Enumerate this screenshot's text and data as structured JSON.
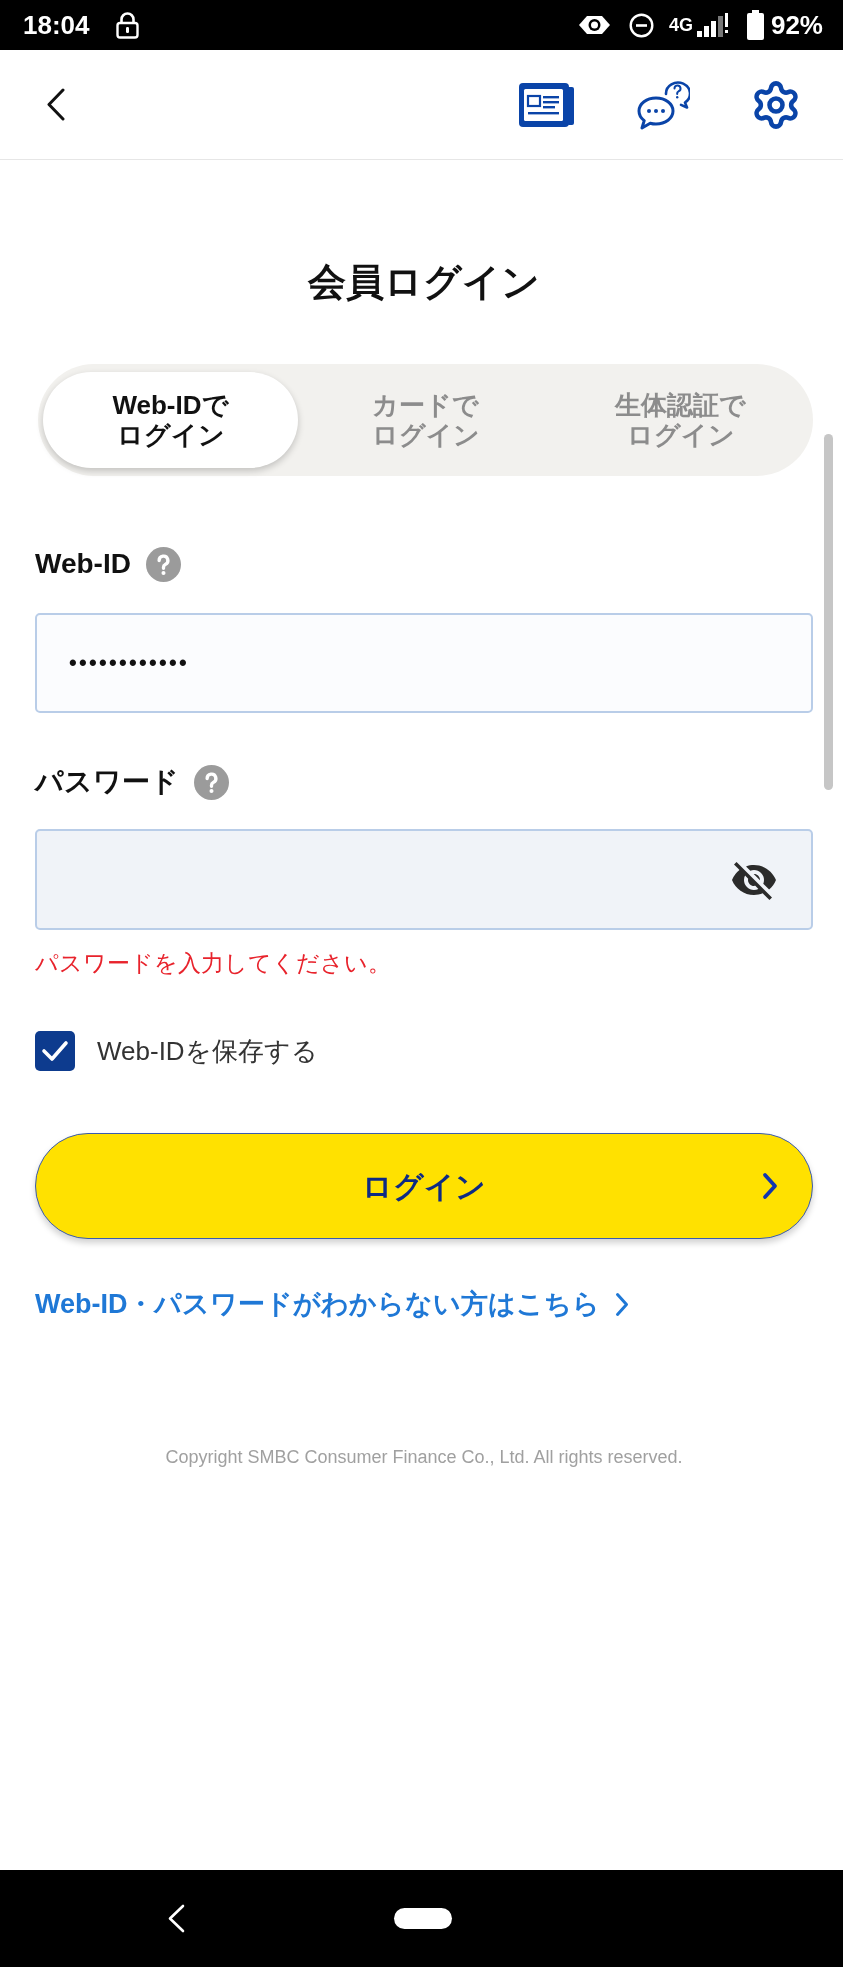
{
  "status_bar": {
    "time": "18:04",
    "network": "4G",
    "battery": "92%"
  },
  "title": "会員ログイン",
  "tabs": [
    {
      "lines": [
        "Web-IDで",
        "ログイン"
      ],
      "selected": true
    },
    {
      "lines": [
        "カードで",
        "ログイン"
      ],
      "selected": false
    },
    {
      "lines": [
        "生体認証で",
        "ログイン"
      ],
      "selected": false
    }
  ],
  "fields": [
    {
      "kind": "text",
      "label": "Web-ID",
      "value": "••••••••••••"
    },
    {
      "kind": "password",
      "label": "パスワード",
      "error": "パスワードを入力してください。"
    }
  ],
  "save_id": {
    "label": "Web-IDを保存する",
    "checked": true
  },
  "login_button": {
    "label": "ログイン"
  },
  "help_link": {
    "label": "Web-ID・パスワードがわからない方はこちら"
  },
  "copyright": "Copyright SMBC Consumer Finance Co., Ltd. All rights reserved."
}
